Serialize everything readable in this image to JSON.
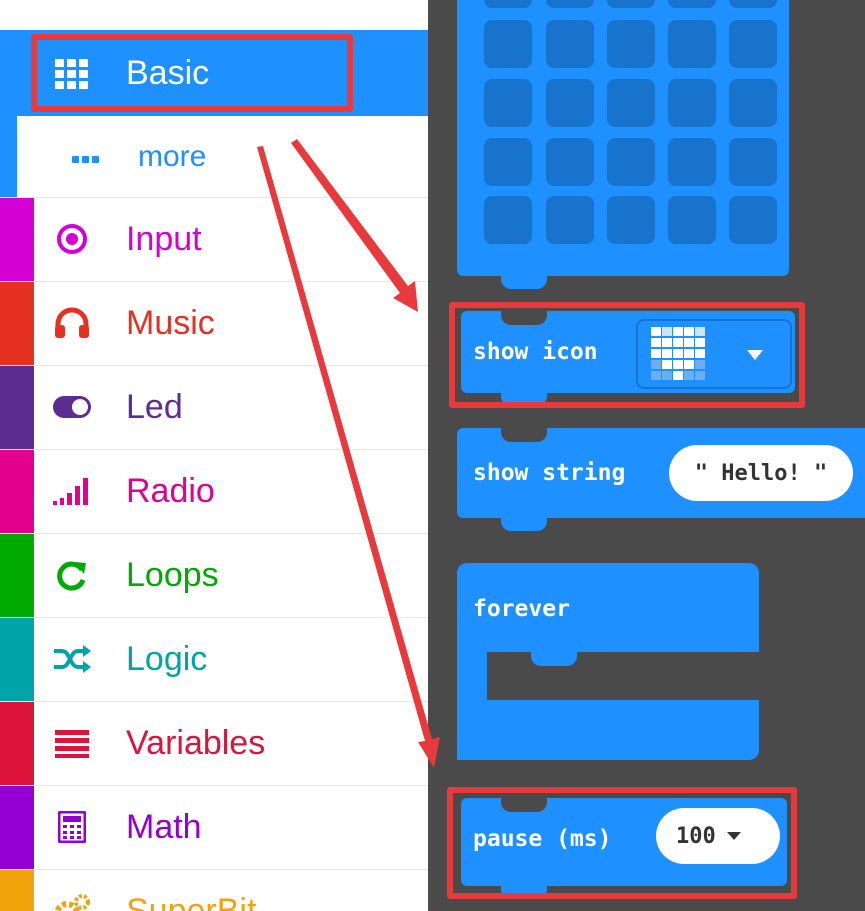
{
  "toolbox": {
    "categories": [
      {
        "label": "Basic",
        "color": "#1e90ff",
        "icon": "grid-icon"
      },
      {
        "label": "more",
        "color": "#1e90ff",
        "icon": "more-dots-icon"
      },
      {
        "label": "Input",
        "color": "#d400d4",
        "icon": "radio-target-icon"
      },
      {
        "label": "Music",
        "color": "#e63022",
        "icon": "headphones-icon"
      },
      {
        "label": "Led",
        "color": "#5c2d91",
        "icon": "toggle-icon"
      },
      {
        "label": "Radio",
        "color": "#e3008c",
        "icon": "signal-bars-icon"
      },
      {
        "label": "Loops",
        "color": "#00aa00",
        "icon": "refresh-icon"
      },
      {
        "label": "Logic",
        "color": "#00a4a6",
        "icon": "shuffle-icon"
      },
      {
        "label": "Variables",
        "color": "#dc143c",
        "icon": "list-lines-icon"
      },
      {
        "label": "Math",
        "color": "#9400d3",
        "icon": "calculator-icon"
      },
      {
        "label": "SuperBit",
        "color": "#f0a30a",
        "icon": "gears-icon"
      }
    ]
  },
  "workspace": {
    "background": "#4a4a4a",
    "block_color": "#1e90ff",
    "show_icon": {
      "label": "show icon",
      "icon": "heart-icon",
      "dropdown": "chevron-down-icon"
    },
    "show_string": {
      "label": "show string",
      "value": "\" Hello! \""
    },
    "forever": {
      "label": "forever"
    },
    "pause": {
      "label": "pause (ms)",
      "value": "100"
    }
  },
  "annotations": {
    "highlight_color": "#e8393c"
  }
}
